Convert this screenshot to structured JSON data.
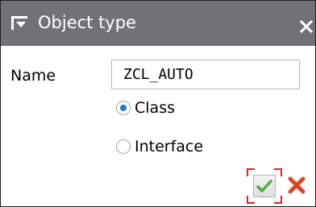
{
  "dialog": {
    "title": "Object type",
    "title_icon": "dialog-window-icon",
    "close_icon": "close-icon"
  },
  "form": {
    "name_label": "Name",
    "name_value": "ZCL_AUTO",
    "options": [
      {
        "label": "Class",
        "selected": true
      },
      {
        "label": "Interface",
        "selected": false
      }
    ]
  },
  "buttons": {
    "ok_icon": "checkmark-icon",
    "cancel_icon": "red-x-icon"
  },
  "colors": {
    "titlebar": "#707375",
    "radio_selected": "#1c7ad6",
    "ok_check": "#4caf3a",
    "cancel_x": "#e0451f",
    "focus": "#d9261c"
  }
}
